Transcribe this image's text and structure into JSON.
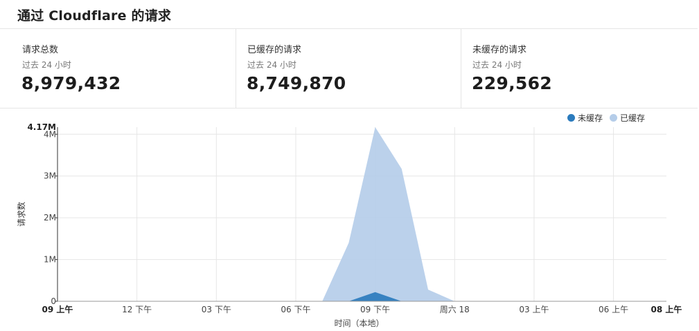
{
  "header": {
    "title": "通过 Cloudflare 的请求"
  },
  "stats": [
    {
      "label": "请求总数",
      "period": "过去 24 小时",
      "value": "8,979,432"
    },
    {
      "label": "已缓存的请求",
      "period": "过去 24 小时",
      "value": "8,749,870"
    },
    {
      "label": "未缓存的请求",
      "period": "过去 24 小时",
      "value": "229,562"
    }
  ],
  "legend": [
    {
      "name": "未缓存",
      "color": "#2b7bbd"
    },
    {
      "name": "已缓存",
      "color": "#b5cde9"
    }
  ],
  "chart_data": {
    "type": "area",
    "ylabel": "请求数",
    "xlabel": "时间（本地）",
    "y_max_label": "4.17M",
    "ylim": [
      0,
      4170000
    ],
    "y_ticks": [
      {
        "label": "0",
        "value": 0
      },
      {
        "label": "1M",
        "value": 1000000
      },
      {
        "label": "2M",
        "value": 2000000
      },
      {
        "label": "3M",
        "value": 3000000
      },
      {
        "label": "4M",
        "value": 4000000
      }
    ],
    "x_ticks": [
      {
        "label": "09 上午",
        "hour": 0,
        "bold": true
      },
      {
        "label": "12 下午",
        "hour": 3,
        "bold": false
      },
      {
        "label": "03 下午",
        "hour": 6,
        "bold": false
      },
      {
        "label": "06 下午",
        "hour": 9,
        "bold": false
      },
      {
        "label": "09 下午",
        "hour": 12,
        "bold": false
      },
      {
        "label": "周六 18",
        "hour": 15,
        "bold": false
      },
      {
        "label": "03 上午",
        "hour": 18,
        "bold": false
      },
      {
        "label": "06 上午",
        "hour": 21,
        "bold": false
      },
      {
        "label": "08 上午",
        "hour": 23,
        "bold": true
      }
    ],
    "x_range_hours": [
      0,
      23
    ],
    "grid": true,
    "series": [
      {
        "name": "已缓存",
        "color": "#b5cde9",
        "points": [
          [
            0,
            0
          ],
          [
            10,
            0
          ],
          [
            11,
            1400000
          ],
          [
            12,
            4170000
          ],
          [
            13,
            3170000
          ],
          [
            14,
            280000
          ],
          [
            15,
            0
          ],
          [
            23,
            0
          ]
        ]
      },
      {
        "name": "未缓存",
        "color": "#2b7bbd",
        "points": [
          [
            0,
            0
          ],
          [
            11,
            0
          ],
          [
            12,
            220000
          ],
          [
            13,
            0
          ],
          [
            23,
            0
          ]
        ]
      }
    ]
  }
}
